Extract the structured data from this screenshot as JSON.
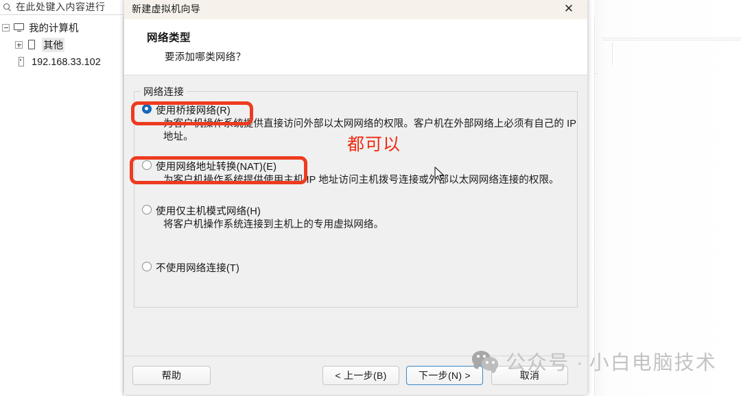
{
  "background": {
    "search_placeholder": "在此处键入内容进行",
    "search_icon": "search-icon",
    "tree": [
      {
        "label": "我的计算机",
        "icon": "monitor-icon",
        "expander": "minus"
      },
      {
        "label": "其他",
        "icon": "folder-icon",
        "expander": "plus"
      },
      {
        "label": "192.168.33.102",
        "icon": "server-icon",
        "expander": "none"
      }
    ]
  },
  "dialog": {
    "title": "新建虚拟机向导",
    "close_icon": "close-icon",
    "heading": "网络类型",
    "subheading": "要添加哪类网络？",
    "groupbox_legend": "网络连接",
    "options": [
      {
        "label": "使用桥接网络(R)",
        "selected": true,
        "description": "为客户机操作系统提供直接访问外部以太网网络的权限。客户机在外部网络上必须有自己的 IP 地址。"
      },
      {
        "label": "使用网络地址转换(NAT)(E)",
        "selected": false,
        "description": "为客户机操作系统提供使用主机 IP 地址访问主机拨号连接或外部以太网网络连接的权限。"
      },
      {
        "label": "使用仅主机模式网络(H)",
        "selected": false,
        "description": "将客户机操作系统连接到主机上的专用虚拟网络。"
      },
      {
        "label": "不使用网络连接(T)",
        "selected": false,
        "description": ""
      }
    ],
    "buttons": {
      "help": "帮助",
      "back": "< 上一步(B)",
      "next": "下一步(N) >",
      "cancel": "取消"
    }
  },
  "annotations": {
    "note_text": "都可以",
    "highlight_color": "#ee3b20",
    "note_color": "#ee2b10",
    "boxed_options": [
      "使用桥接网络(R)",
      "使用网络地址转换(NAT)(E)"
    ]
  },
  "watermark": {
    "prefix": "公众号 ·",
    "name": "小白电脑技术",
    "logo_icon": "wechat-logo-icon"
  }
}
